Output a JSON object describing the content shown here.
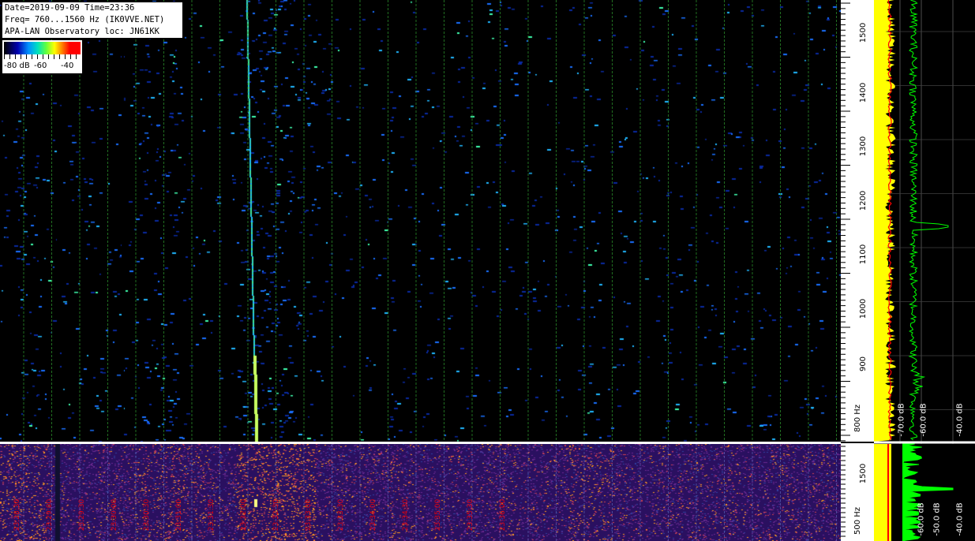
{
  "header": {
    "line1": "Date=2019-09-09 Time=23:36",
    "line2": "Freq= 760...1560 Hz (IK0VVE.NET)",
    "line3": "APA-LAN Observatory loc: JN61KK"
  },
  "legend": {
    "low": "-80 dB",
    "mid": "-60",
    "high": "-40"
  },
  "freq_axis_top": {
    "labels": [
      "1500",
      "1400",
      "1300",
      "1200",
      "1100",
      "1000",
      "900",
      "800 Hz"
    ]
  },
  "freq_axis_bottom": {
    "labels": [
      "1500",
      "500 Hz"
    ]
  },
  "power_axis_top": {
    "labels": [
      "-70.0 dB",
      "-60.0 dB",
      "-40.0 dB"
    ]
  },
  "power_axis_bottom": {
    "labels": [
      "-60.0 dB",
      "-50.0 dB",
      "-40.0 dB"
    ]
  },
  "time_axis": {
    "labels": [
      "23:28:30",
      "23:29:00",
      "23:29:30",
      "23:30:00",
      "23:30:30",
      "23:31:00",
      "23:31:30",
      "23:32:00",
      "23:32:30",
      "23:33:00",
      "23:33:30",
      "23:34:00",
      "23:34:30",
      "23:35:00",
      "23:35:30",
      "23:36:00"
    ]
  },
  "colors": {
    "waterfall_bg": "#000000",
    "waterfall_blue": "#1060ff",
    "meteor_green": "#60ff60",
    "bottom_bg": "#3a1a6a",
    "bottom_hot": "#ff9a20",
    "grid_green": "#2a8a2a",
    "trace_yellow": "#ffff00",
    "trace_green": "#00ff00",
    "trace_red": "#ff0000"
  }
}
